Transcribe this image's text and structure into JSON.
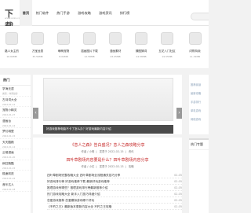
{
  "header": {
    "logo_text": "下载",
    "logo_sub": "www.xxxx.com",
    "nav": [
      {
        "label": "首页",
        "active": true
      },
      {
        "label": "热门软件",
        "active": false
      },
      {
        "label": "热门手游",
        "active": false
      },
      {
        "label": "游戏攻略",
        "active": false
      },
      {
        "label": "游戏资讯",
        "active": false
      },
      {
        "label": "排行榜",
        "active": false
      }
    ]
  },
  "apps": [
    {
      "name": "路人女主的",
      "size": "16.69MB"
    },
    {
      "name": "万宝龙表",
      "size": "35.56MB"
    },
    {
      "name": "萌萌宠物",
      "size": "8.04MB"
    },
    {
      "name": "插画图片下载",
      "size": "12.58MB"
    },
    {
      "name": "漫画素材",
      "size": "43.05MB"
    },
    {
      "name": "猜图猜词",
      "size": "24.58MB"
    },
    {
      "name": "五花八门社区",
      "size": "19.55MB"
    },
    {
      "name": "闪购特卖",
      "size": "11.32MB"
    }
  ],
  "left": {
    "title": "热门",
    "items": [
      {
        "title": "学海无涯",
        "sub": "类别：休闲益智"
      },
      {
        "title": "古诗词大全",
        "sub": "2022-01-12"
      },
      {
        "title": "宠物小精灵",
        "sub": "2022-01-27"
      },
      {
        "title": "漫画台",
        "sub": "2022-01-12"
      },
      {
        "title": "梦幻城堡",
        "sub": "2022-01-15"
      },
      {
        "title": "天天酷跑",
        "sub": "2022-01-12"
      },
      {
        "title": "云端漫画",
        "sub": "2022-01-20"
      },
      {
        "title": "疯狂跑酷",
        "sub": "2022-01-15"
      },
      {
        "title": "极速前进",
        "sub": "2022-01-22"
      },
      {
        "title": "音乐达人",
        "sub": "2022-01-18"
      }
    ]
  },
  "banner": {
    "caption": "好游戏推荐电脑不卡了怎么办？好游戏最新内容介绍",
    "prev": "‹",
    "next": "›"
  },
  "articles": [
    {
      "title": "《恋人之森》告白盛况？恋人之森攻略分享",
      "meta": [
        "作者 / 小明",
        "发表于 2022-02-15",
        "资讯"
      ],
      "color": "#c62828"
    },
    {
      "title": "四叶草剧场内容要是什么？四叶草剧场内容分享",
      "meta": [
        "作者 / 小红",
        "发表于 2022-02-13",
        "攻略"
      ],
      "color": "#c62828"
    }
  ],
  "news": [
    {
      "title": "四叶草剧场完整攻略大全 四叶草剧场全流程通关技巧分享",
      "date": "02-05"
    },
    {
      "title": "好游戏排行榜 好游戏推荐下载 最新好玩游戏推荐",
      "date": "02-05"
    },
    {
      "title": "推理游戏有哪些？推理游戏排行榜最新推荐介绍",
      "date": "02-05"
    },
    {
      "title": "热门游戏攻略大全 新手入门技巧详细介绍",
      "date": "02-05"
    },
    {
      "title": "恋爱游戏推荐 恋爱模拟游戏哪个好玩",
      "date": "02-05"
    },
    {
      "title": "《不朽之王》最新版本更新内容大全 不朽之王攻略",
      "date": "02-05"
    }
  ],
  "right": {
    "items": [
      "推荐阅读",
      "最新攻略",
      "手游排行",
      "单机游戏",
      "网络游戏",
      "热门专题"
    ],
    "special_title": "热门专题"
  }
}
